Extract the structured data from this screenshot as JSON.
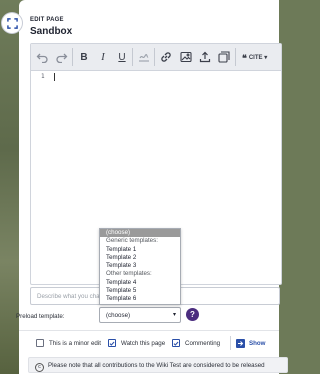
{
  "header": {
    "eyebrow": "EDIT PAGE",
    "title": "Sandbox"
  },
  "toolbar": {
    "cite_label": "CITE",
    "cite_chevron": "▾"
  },
  "editor": {
    "line_number": "1"
  },
  "summary": {
    "placeholder": "Describe what you changed"
  },
  "preload": {
    "label": "Preload template:",
    "selected": "(choose)",
    "help": "?",
    "dropdown": [
      {
        "text": "(choose)",
        "kind": "selected"
      },
      {
        "text": "Generic templates:",
        "kind": "group"
      },
      {
        "text": "Template 1",
        "kind": "opt"
      },
      {
        "text": "Template 2",
        "kind": "opt"
      },
      {
        "text": "Template 3",
        "kind": "opt"
      },
      {
        "text": "Other templates:",
        "kind": "group"
      },
      {
        "text": "Template 4",
        "kind": "opt"
      },
      {
        "text": "Template 5",
        "kind": "opt"
      },
      {
        "text": "Template 6",
        "kind": "opt"
      }
    ]
  },
  "options": {
    "minor_edit": "This is a minor edit",
    "minor_checked": false,
    "watch": "Watch this page",
    "watch_checked": true,
    "commenting": "Commenting",
    "commenting_checked": true,
    "show_label": "Show"
  },
  "notice": {
    "text": "Please note that all contributions to the Wiki Test are considered to be released"
  },
  "colors": {
    "accent": "#2a4fa8",
    "help_bg": "#4b2d7f"
  }
}
